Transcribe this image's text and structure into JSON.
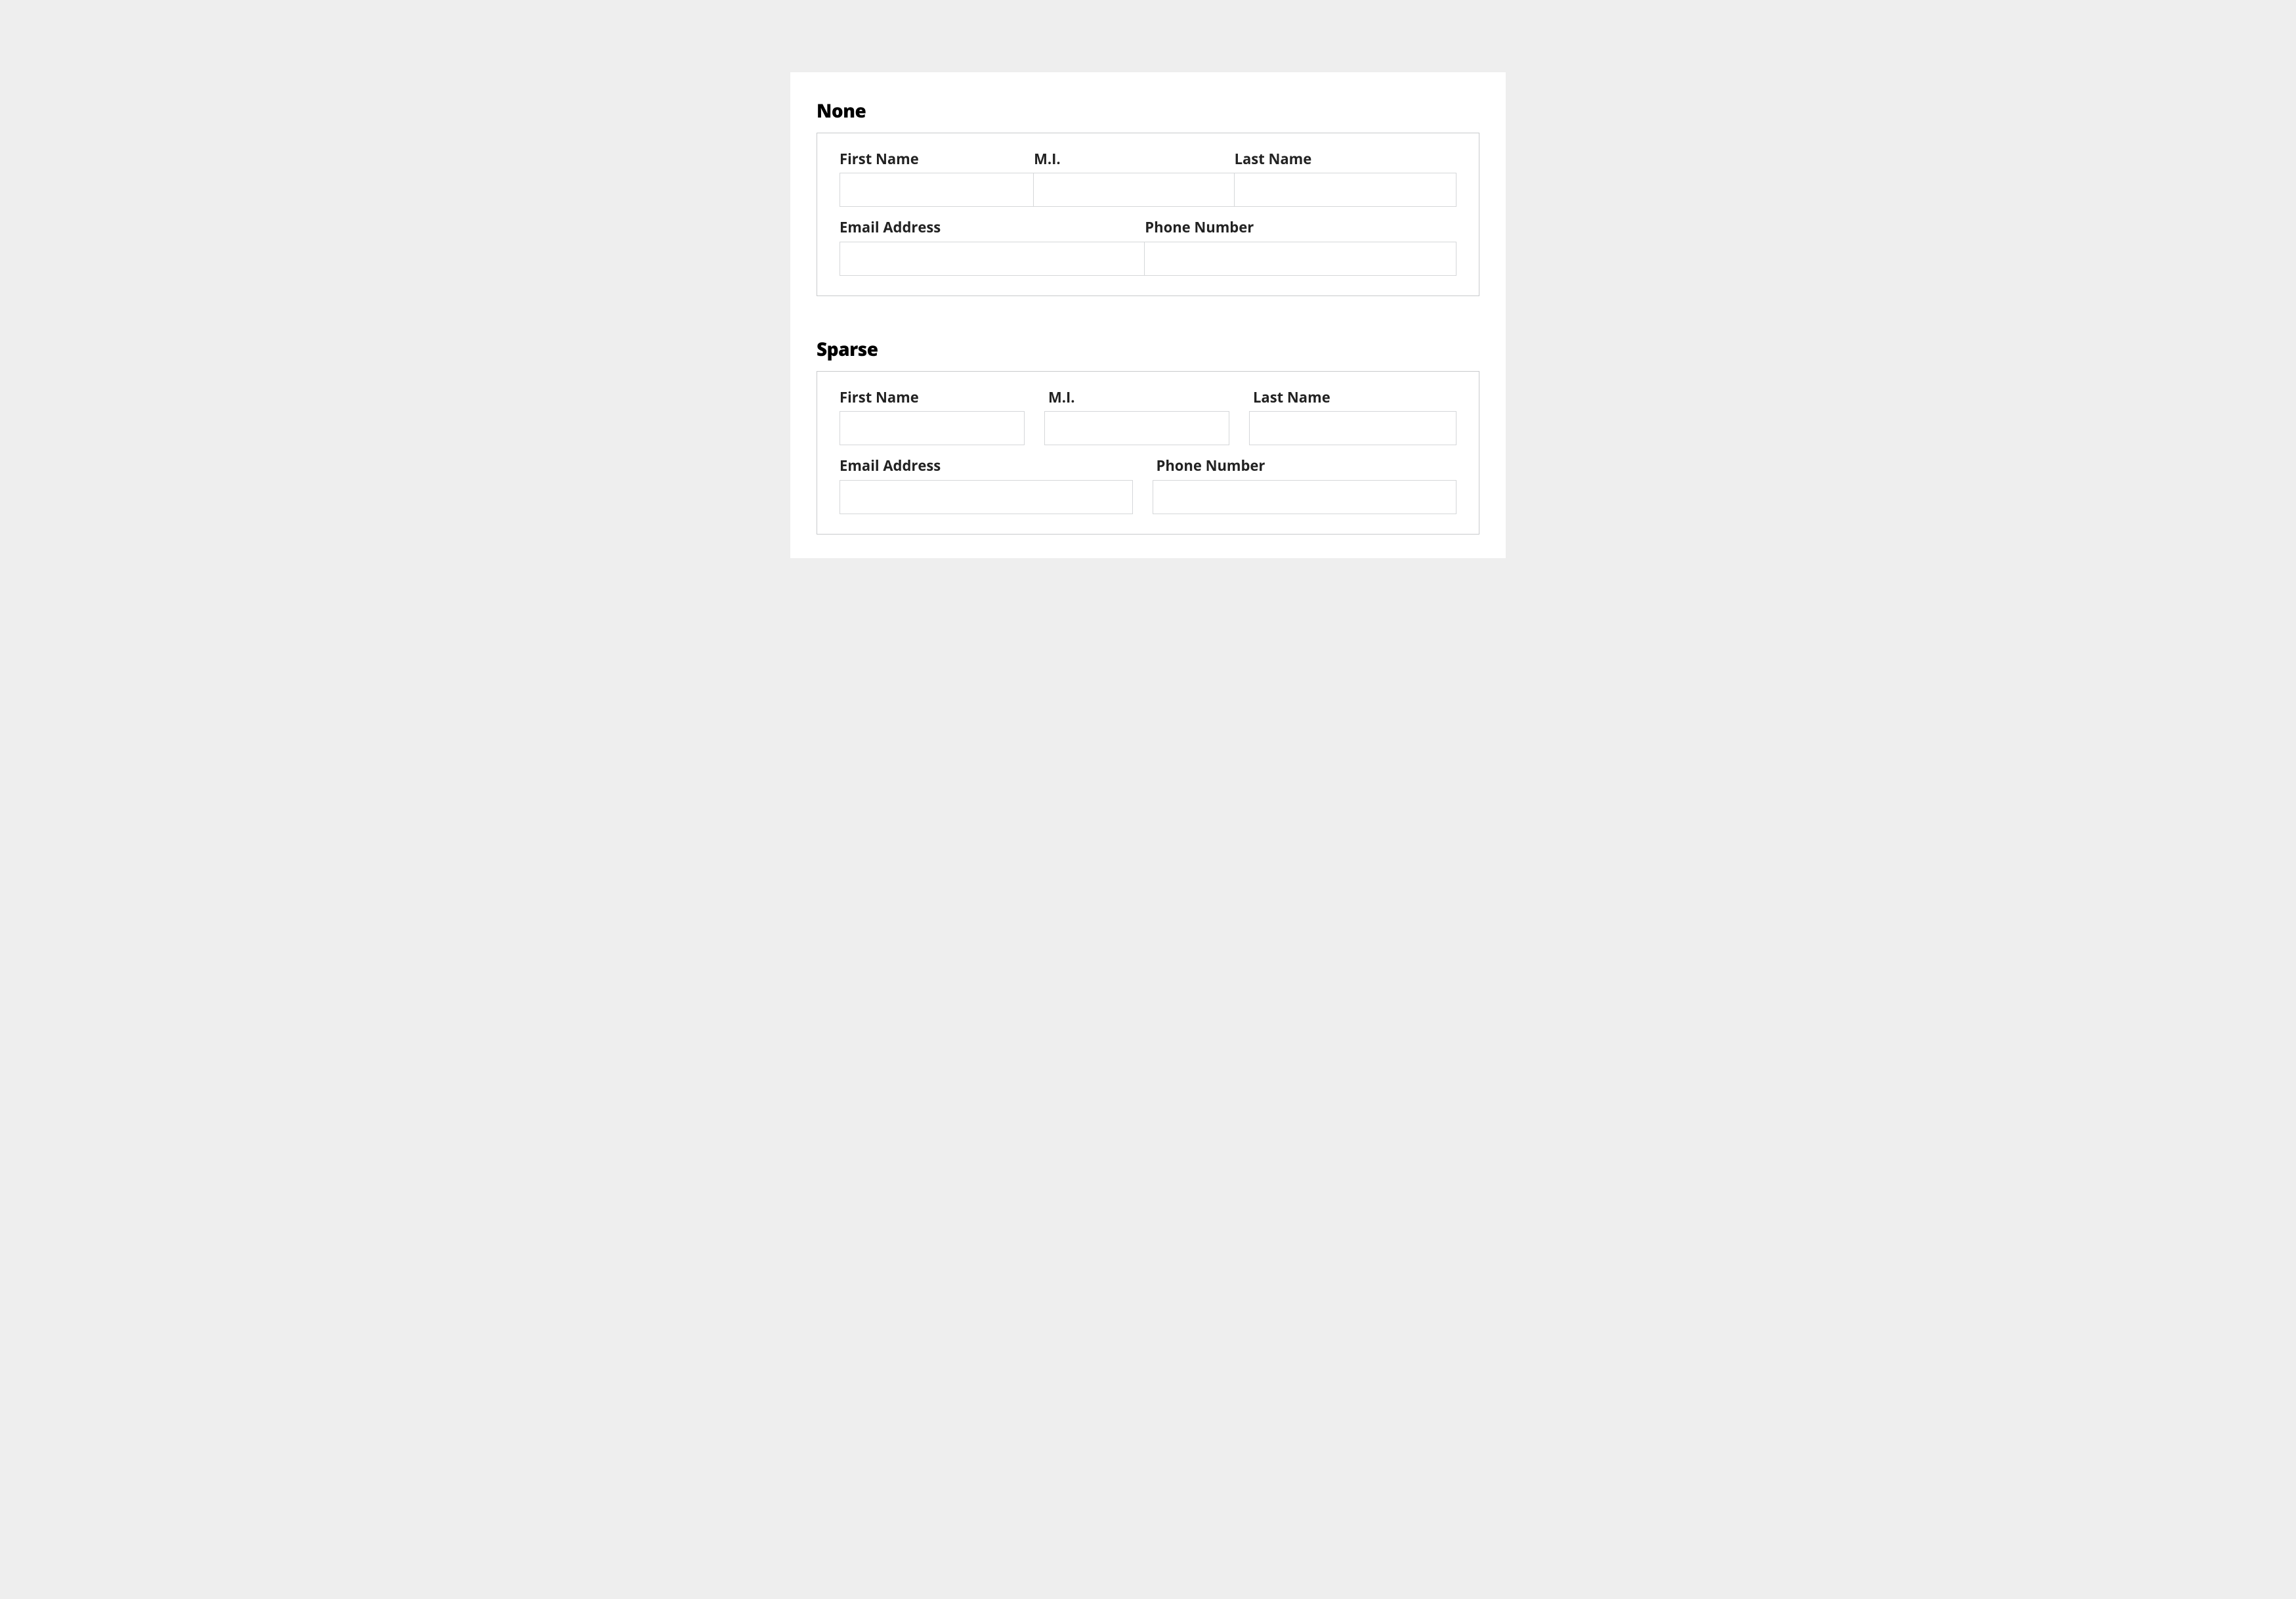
{
  "none": {
    "title": "None",
    "fields": {
      "first_name": {
        "label": "First Name",
        "value": ""
      },
      "mi": {
        "label": "M.I.",
        "value": ""
      },
      "last_name": {
        "label": "Last Name",
        "value": ""
      },
      "email": {
        "label": "Email Address",
        "value": ""
      },
      "phone": {
        "label": "Phone Number",
        "value": ""
      }
    }
  },
  "sparse": {
    "title": "Sparse",
    "fields": {
      "first_name": {
        "label": "First Name",
        "value": ""
      },
      "mi": {
        "label": "M.I.",
        "value": ""
      },
      "last_name": {
        "label": "Last Name",
        "value": ""
      },
      "email": {
        "label": "Email Address",
        "value": ""
      },
      "phone": {
        "label": "Phone Number",
        "value": ""
      }
    }
  }
}
